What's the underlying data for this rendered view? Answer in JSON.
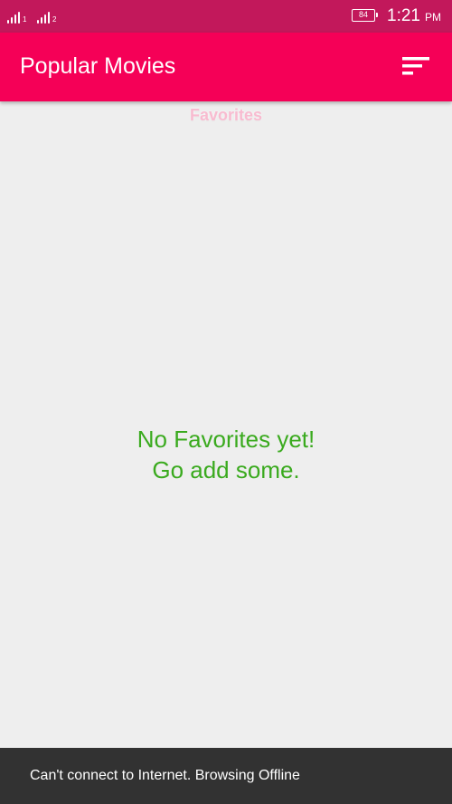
{
  "status_bar": {
    "sim1_label": "1",
    "sim2_label": "2",
    "battery_level": "84",
    "time": "1:21",
    "ampm": "PM"
  },
  "app_bar": {
    "title": "Popular Movies",
    "sort_icon": "sort-icon"
  },
  "section": {
    "label": "Favorites"
  },
  "empty_state": {
    "line1": "No Favorites yet!",
    "line2": "Go add some."
  },
  "snackbar": {
    "message": "Can't connect to Internet. Browsing Offline"
  },
  "colors": {
    "status_bar": "#c2185b",
    "app_bar": "#f50057",
    "background": "#eeeeee",
    "empty_text": "#3aaa1e",
    "snackbar": "#323232"
  }
}
